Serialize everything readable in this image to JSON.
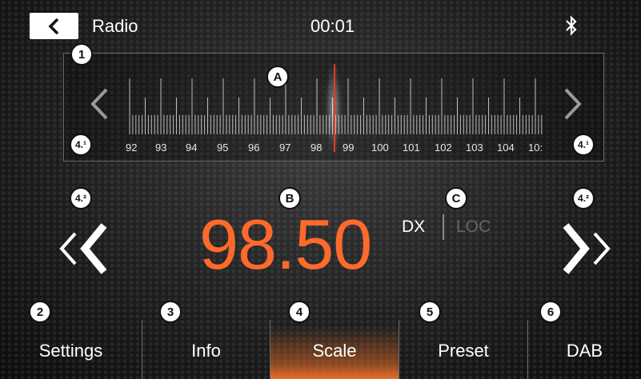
{
  "header": {
    "title": "Radio",
    "clock": "00:01"
  },
  "scale": {
    "ticks": [
      "92",
      "93",
      "94",
      "95",
      "96",
      "97",
      "98",
      "99",
      "100",
      "101",
      "102",
      "103",
      "104",
      "10:"
    ],
    "accent": "#e63a2a"
  },
  "tuner": {
    "frequency": "98.50",
    "dx_label": "DX",
    "loc_label": "LOC",
    "accent": "#ff6a2c"
  },
  "badges": {
    "one": "1",
    "a": "A",
    "four_one": "4.¹",
    "four_two": "4.²",
    "b": "B",
    "c": "C",
    "two": "2",
    "three": "3",
    "four": "4",
    "five": "5",
    "six": "6"
  },
  "tabs": [
    {
      "label": "Settings"
    },
    {
      "label": "Info"
    },
    {
      "label": "Scale"
    },
    {
      "label": "Preset"
    },
    {
      "label": "DAB"
    }
  ]
}
